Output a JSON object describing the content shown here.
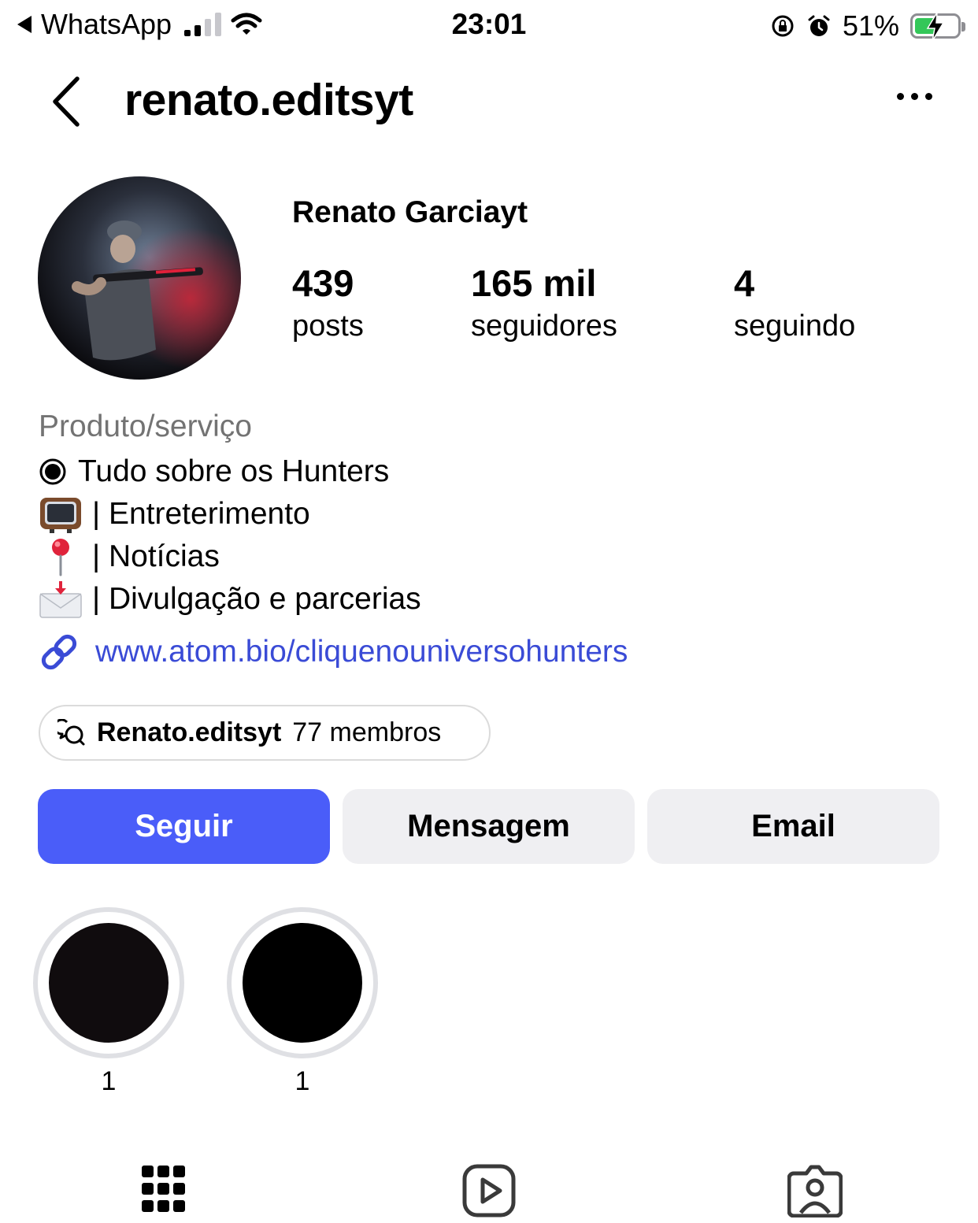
{
  "status_bar": {
    "back_app": "WhatsApp",
    "time": "23:01",
    "battery_percent": "51%",
    "battery_level": 0.51,
    "charging": true
  },
  "header": {
    "username": "renato.editsyt"
  },
  "profile": {
    "display_name": "Renato Garciayt",
    "stats": [
      {
        "value": "439",
        "label": "posts"
      },
      {
        "value": "165 mil",
        "label": "seguidores"
      },
      {
        "value": "4",
        "label": "seguindo"
      }
    ],
    "category": "Produto/serviço",
    "bio_lines": [
      {
        "icon": "radio-dot-icon",
        "text": "Tudo sobre os Hunters"
      },
      {
        "icon": "tv-icon",
        "text": "| Entreterimento"
      },
      {
        "icon": "pushpin-icon",
        "text": "| Notícias"
      },
      {
        "icon": "envelope-icon",
        "text": "| Divulgação e parcerias"
      }
    ],
    "link": "www.atom.bio/cliquenouniversohunters"
  },
  "community": {
    "name": "Renato.editsyt",
    "members": "77 membros"
  },
  "actions": {
    "follow": "Seguir",
    "message": "Mensagem",
    "email": "Email"
  },
  "highlights": [
    {
      "label": "1"
    },
    {
      "label": "1"
    }
  ],
  "colors": {
    "follow_button": "#4a5df9",
    "link": "#3a4bd6",
    "secondary_button": "#efeff2"
  }
}
